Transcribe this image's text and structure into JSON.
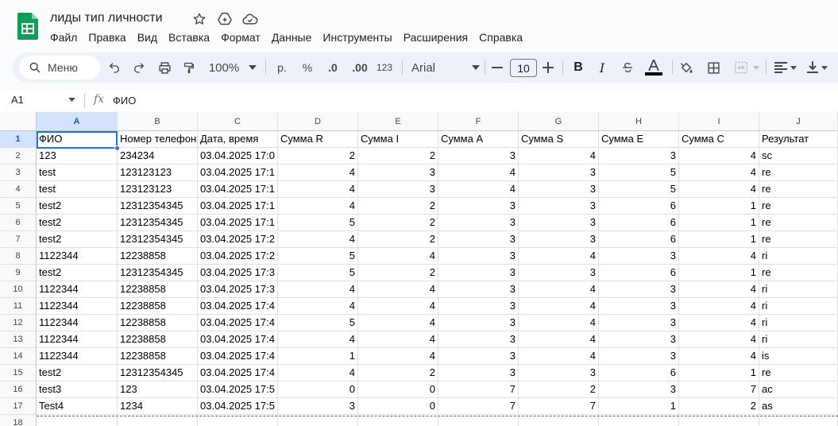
{
  "app": {
    "title": "лиды тип личности",
    "icons": [
      "star-icon",
      "move-to-drive-icon",
      "cloud-status-icon"
    ]
  },
  "menu": [
    "Файл",
    "Правка",
    "Вид",
    "Вставка",
    "Формат",
    "Данные",
    "Инструменты",
    "Расширения",
    "Справка"
  ],
  "toolbar": {
    "search_label": "Меню",
    "zoom": "100%",
    "currency": "р.",
    "percent": "%",
    "decrease_decimal": ".0",
    "increase_decimal": ".00",
    "number_format": "123",
    "font": "Arial",
    "font_size": "10",
    "bold": "B",
    "italic": "I",
    "text_color_accent": "#000000"
  },
  "formula_bar": {
    "cell_ref": "A1",
    "fx": "fx",
    "value": "ФИО"
  },
  "grid": {
    "columns": [
      "A",
      "B",
      "C",
      "D",
      "E",
      "F",
      "G",
      "H",
      "I",
      "J"
    ],
    "selected_column": "A",
    "selected_row": "1",
    "rows": [
      {
        "num": "1",
        "cells": [
          "ФИО",
          "Номер телефона",
          "Дата, время",
          "Сумма R",
          "Сумма I",
          "Сумма A",
          "Сумма S",
          "Сумма E",
          "Сумма C",
          "Результат"
        ]
      },
      {
        "num": "2",
        "cells": [
          "123",
          "234234",
          "03.04.2025 17:0",
          "2",
          "2",
          "3",
          "4",
          "3",
          "4",
          "sc"
        ]
      },
      {
        "num": "3",
        "cells": [
          "test",
          "123123123",
          "03.04.2025 17:1",
          "4",
          "3",
          "4",
          "3",
          "5",
          "4",
          "re"
        ]
      },
      {
        "num": "4",
        "cells": [
          "test",
          "123123123",
          "03.04.2025 17:1",
          "4",
          "3",
          "4",
          "3",
          "5",
          "4",
          "re"
        ]
      },
      {
        "num": "5",
        "cells": [
          "test2",
          "12312354345",
          "03.04.2025 17:1",
          "4",
          "2",
          "3",
          "3",
          "6",
          "1",
          "re"
        ]
      },
      {
        "num": "6",
        "cells": [
          "test2",
          "12312354345",
          "03.04.2025 17:1",
          "5",
          "2",
          "3",
          "3",
          "6",
          "1",
          "re"
        ]
      },
      {
        "num": "7",
        "cells": [
          "test2",
          "12312354345",
          "03.04.2025 17:2",
          "4",
          "2",
          "3",
          "3",
          "6",
          "1",
          "re"
        ]
      },
      {
        "num": "8",
        "cells": [
          "1122344",
          "12238858",
          "03.04.2025 17:2",
          "5",
          "4",
          "3",
          "4",
          "3",
          "4",
          "ri"
        ]
      },
      {
        "num": "9",
        "cells": [
          "test2",
          "12312354345",
          "03.04.2025 17:3",
          "5",
          "2",
          "3",
          "3",
          "6",
          "1",
          "re"
        ]
      },
      {
        "num": "10",
        "cells": [
          "1122344",
          "12238858",
          "03.04.2025 17:3",
          "4",
          "4",
          "3",
          "4",
          "3",
          "4",
          "ri"
        ]
      },
      {
        "num": "11",
        "cells": [
          "1122344",
          "12238858",
          "03.04.2025 17:4",
          "4",
          "4",
          "3",
          "4",
          "3",
          "4",
          "ri"
        ]
      },
      {
        "num": "12",
        "cells": [
          "1122344",
          "12238858",
          "03.04.2025 17:4",
          "5",
          "4",
          "3",
          "4",
          "3",
          "4",
          "ri"
        ]
      },
      {
        "num": "13",
        "cells": [
          "1122344",
          "12238858",
          "03.04.2025 17:4",
          "4",
          "4",
          "3",
          "4",
          "3",
          "4",
          "ri"
        ]
      },
      {
        "num": "14",
        "cells": [
          "1122344",
          "12238858",
          "03.04.2025 17:4",
          "1",
          "4",
          "3",
          "4",
          "3",
          "4",
          "is"
        ]
      },
      {
        "num": "15",
        "cells": [
          "test2",
          "12312354345",
          "03.04.2025 17:4",
          "4",
          "2",
          "3",
          "3",
          "6",
          "1",
          "re"
        ]
      },
      {
        "num": "16",
        "cells": [
          "test3",
          "123",
          "03.04.2025 17:5",
          "0",
          "0",
          "7",
          "2",
          "3",
          "7",
          "ac"
        ]
      },
      {
        "num": "17",
        "cells": [
          "Test4",
          "1234",
          "03.04.2025 17:5",
          "3",
          "0",
          "7",
          "7",
          "1",
          "2",
          "as"
        ]
      },
      {
        "num": "18",
        "cells": [
          "",
          "",
          "",
          "",
          "",
          "",
          "",
          "",
          "",
          ""
        ]
      }
    ]
  }
}
